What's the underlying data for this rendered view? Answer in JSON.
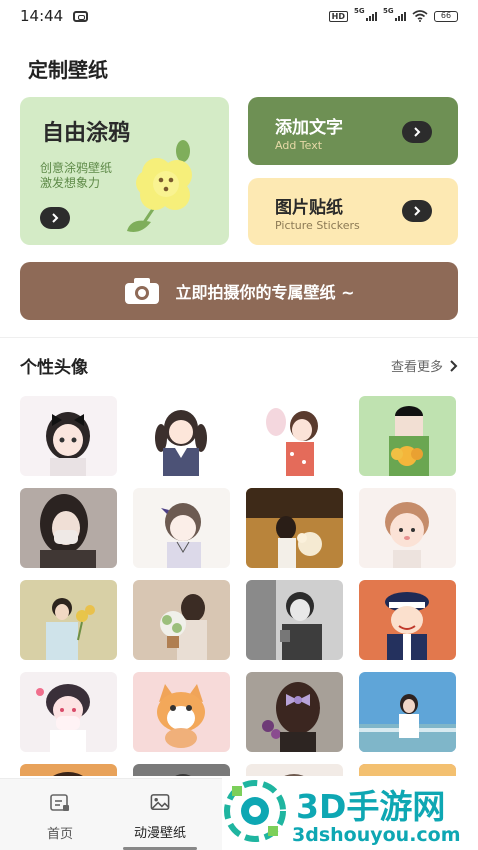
{
  "status_bar": {
    "time": "14:44",
    "network_labels": [
      "5G",
      "5G"
    ],
    "hd_label": "HD",
    "battery": "66"
  },
  "section_title": "定制壁纸",
  "cards": {
    "doodle": {
      "title": "自由涂鸦",
      "subtitle_line1": "创意涂鸦壁纸",
      "subtitle_line2": "激发想象力"
    },
    "add_text": {
      "title": "添加文字",
      "subtitle": "Add Text"
    },
    "stickers": {
      "title": "图片贴纸",
      "subtitle": "Picture Stickers"
    }
  },
  "photo_bar": {
    "label": "立即拍摄你的专属壁纸 ~"
  },
  "avatars_section": {
    "title": "个性头像",
    "more_label": "查看更多"
  },
  "avatar_tiles": [
    "avatar-girl-black-bow",
    "avatar-girl-pigtails",
    "avatar-girl-bunny",
    "avatar-boy-flowers-green",
    "avatar-girl-mask",
    "avatar-girl-sketch",
    "avatar-girl-bouquet-orange",
    "avatar-boy-cartoon",
    "avatar-boy-sunflowers",
    "avatar-girl-flowers-beige",
    "avatar-boy-bw",
    "avatar-police-cartoon",
    "avatar-girl-pink-hands",
    "avatar-cat-cartoon",
    "avatar-girl-purple-bow",
    "avatar-girl-sea",
    "avatar-row5-1",
    "avatar-row5-2",
    "avatar-row5-3",
    "avatar-row5-4"
  ],
  "tabbar": {
    "home_label": "首页",
    "anime_label": "动漫壁纸"
  },
  "watermark": {
    "brand": "3D手游网",
    "url": "3dshouyou.com"
  },
  "colors": {
    "doodle_card": "#d4ebc6",
    "text_card": "#6e9054",
    "sticker_card": "#fde9b3",
    "photo_bar": "#8e6a57",
    "watermark": "#0ea7b3"
  }
}
